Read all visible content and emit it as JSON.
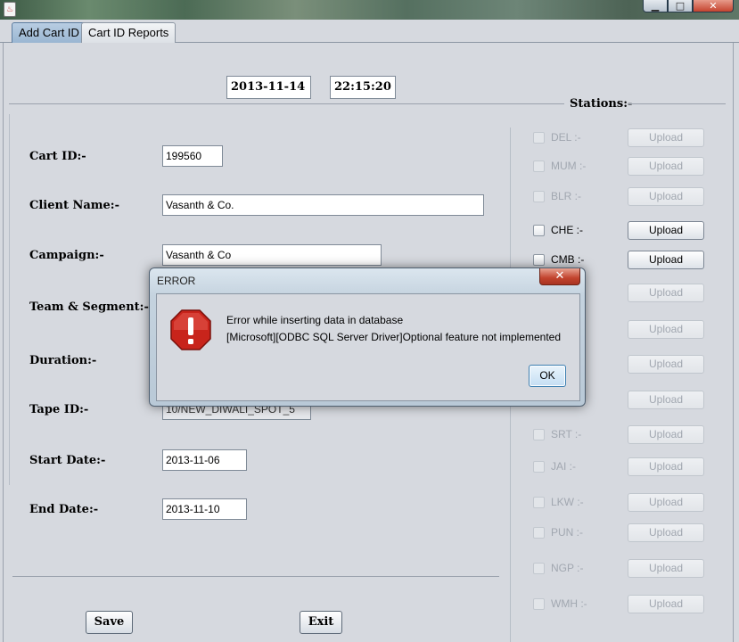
{
  "window": {
    "minimize": "▁",
    "maximize": "□",
    "close": "✕",
    "icon": "java-icon"
  },
  "tabs": [
    {
      "label": "Add Cart ID",
      "active": true
    },
    {
      "label": "Cart ID Reports",
      "active": false
    }
  ],
  "header": {
    "date": "2013-11-14",
    "time": "22:15:20"
  },
  "form": {
    "cart_id_label": "Cart ID:-",
    "cart_id": "199560",
    "client_name_label": "Client Name:-",
    "client_name": "Vasanth & Co.",
    "campaign_label": "Campaign:-",
    "campaign": "Vasanth & Co",
    "team_segment_label": "Team & Segment:-",
    "duration_label": "Duration:-",
    "tape_id_label": "Tape ID:-",
    "tape_id": "10/NEW_DIWALI_SPOT_5",
    "start_date_label": "Start Date:-",
    "start_date": "2013-11-06",
    "end_date_label": "End Date:-",
    "end_date": "2013-11-10"
  },
  "stations": {
    "title": "Stations:-",
    "upload_label": "Upload",
    "items": [
      {
        "name": "DEL :-",
        "enabled": false
      },
      {
        "name": "MUM :-",
        "enabled": false
      },
      {
        "name": "BLR :-",
        "enabled": false
      },
      {
        "name": "CHE :-",
        "enabled": true
      },
      {
        "name": "CMB :-",
        "enabled": true
      },
      {
        "name": "",
        "enabled": false
      },
      {
        "name": "",
        "enabled": false
      },
      {
        "name": "",
        "enabled": false
      },
      {
        "name": "",
        "enabled": false
      },
      {
        "name": "SRT :-",
        "enabled": false
      },
      {
        "name": "JAI :-",
        "enabled": false
      },
      {
        "name": "LKW :-",
        "enabled": false
      },
      {
        "name": "PUN :-",
        "enabled": false
      },
      {
        "name": "NGP :-",
        "enabled": false
      },
      {
        "name": "WMH :-",
        "enabled": false
      }
    ]
  },
  "actions": {
    "save": "Save",
    "exit": "Exit"
  },
  "dialog": {
    "title": "ERROR",
    "close": "✕",
    "icon": "error-icon",
    "message_line1": "Error while inserting data in database",
    "message_line2": " [Microsoft][ODBC SQL Server Driver]Optional feature not implemented",
    "ok_label": "OK"
  }
}
